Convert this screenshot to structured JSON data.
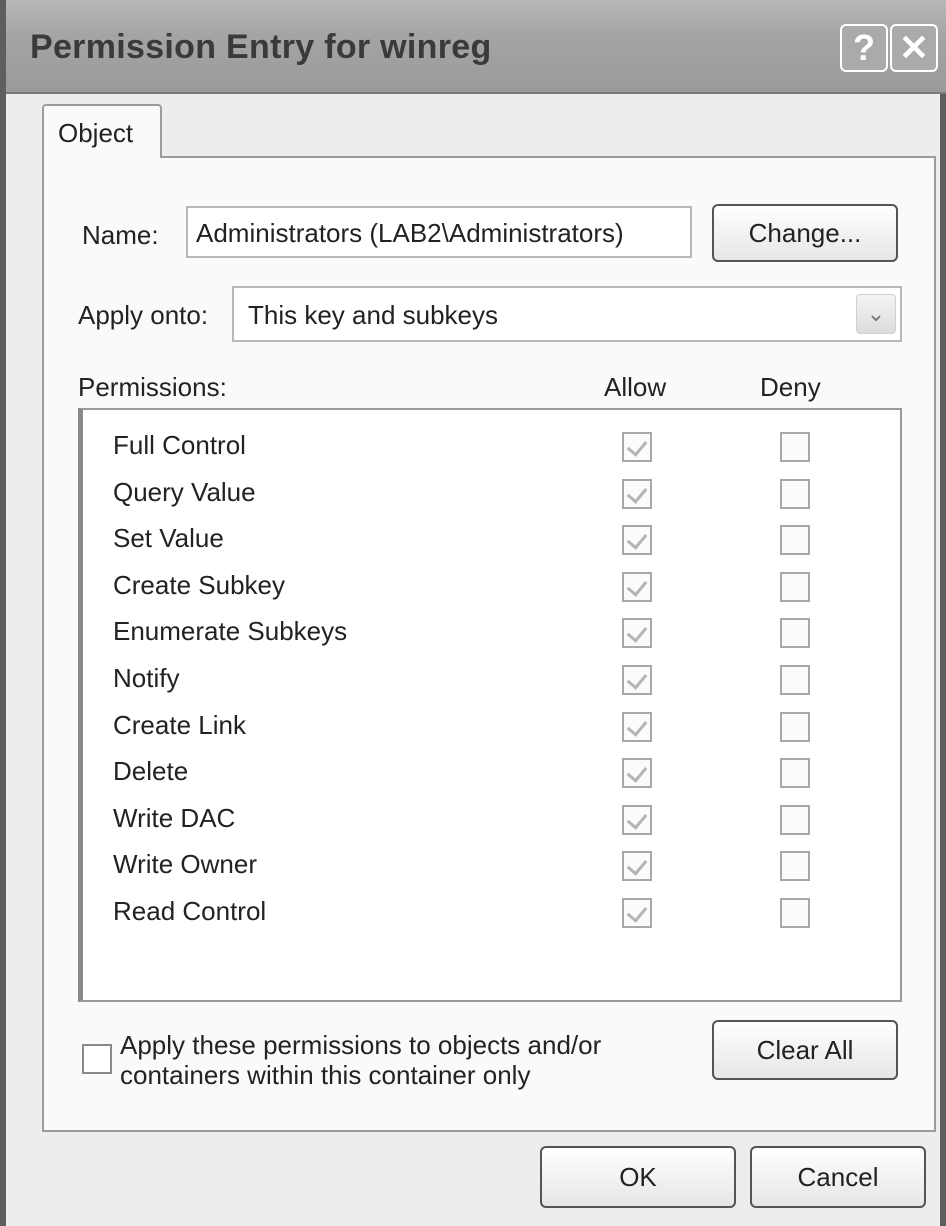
{
  "window": {
    "title": "Permission Entry for winreg",
    "help_glyph": "?",
    "close_glyph": "✕"
  },
  "tabs": [
    {
      "label": "Object",
      "selected": true
    }
  ],
  "name_field": {
    "label": "Name:",
    "value": "Administrators (LAB2\\Administrators)",
    "change_button": "Change..."
  },
  "apply_onto": {
    "label": "Apply onto:",
    "selected": "This key and subkeys"
  },
  "permissions": {
    "header_label": "Permissions:",
    "allow_header": "Allow",
    "deny_header": "Deny",
    "items": [
      {
        "name": "Full Control",
        "allow": true,
        "deny": false
      },
      {
        "name": "Query Value",
        "allow": true,
        "deny": false
      },
      {
        "name": "Set Value",
        "allow": true,
        "deny": false
      },
      {
        "name": "Create Subkey",
        "allow": true,
        "deny": false
      },
      {
        "name": "Enumerate Subkeys",
        "allow": true,
        "deny": false
      },
      {
        "name": "Notify",
        "allow": true,
        "deny": false
      },
      {
        "name": "Create Link",
        "allow": true,
        "deny": false
      },
      {
        "name": "Delete",
        "allow": true,
        "deny": false
      },
      {
        "name": "Write DAC",
        "allow": true,
        "deny": false
      },
      {
        "name": "Write Owner",
        "allow": true,
        "deny": false
      },
      {
        "name": "Read Control",
        "allow": true,
        "deny": false
      }
    ]
  },
  "apply_container_only": {
    "line1": "Apply these permissions to objects and/or",
    "line2": "containers within this container only",
    "checked": false
  },
  "buttons": {
    "clear_all": "Clear All",
    "ok": "OK",
    "cancel": "Cancel"
  }
}
